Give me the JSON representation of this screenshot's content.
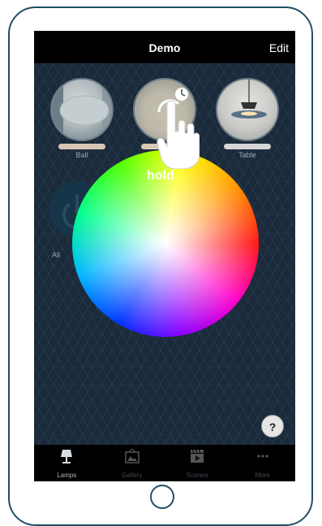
{
  "navbar": {
    "title": "Demo",
    "edit_label": "Edit"
  },
  "lamps": [
    {
      "label": "Ball",
      "bar_color": "#d9c7b5"
    },
    {
      "label": "",
      "bar_color": "#d9c7b5"
    },
    {
      "label": "Table",
      "bar_color": "#d6d6d6"
    }
  ],
  "alloff": {
    "label": "All"
  },
  "gesture": {
    "hint": "hold",
    "icon": "hand-hold-icon"
  },
  "help": {
    "label": "?"
  },
  "tabs": [
    {
      "label": "Lamps",
      "icon": "lamp-icon",
      "active": true
    },
    {
      "label": "Gallery",
      "icon": "gallery-icon",
      "active": false
    },
    {
      "label": "Scenes",
      "icon": "scenes-icon",
      "active": false
    },
    {
      "label": "More",
      "icon": "more-icon",
      "active": false
    }
  ]
}
